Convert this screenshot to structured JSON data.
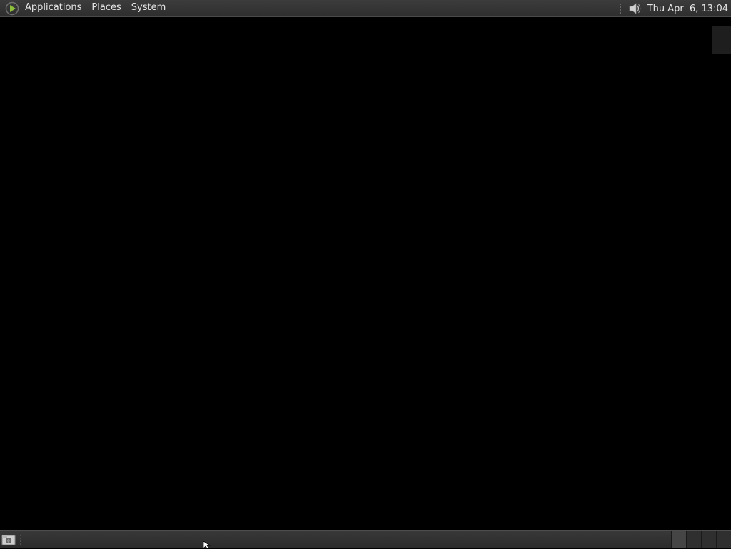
{
  "top_panel": {
    "menus": [
      {
        "label": "Applications"
      },
      {
        "label": "Places"
      },
      {
        "label": "System"
      }
    ],
    "logo_icon": "mandriva-star-icon",
    "tray": {
      "volume_icon": "speaker-volume-icon",
      "clock": "Thu Apr  6, 13:04"
    }
  },
  "bottom_panel": {
    "show_desktop_icon": "show-desktop-icon",
    "workspaces": [
      {
        "name": "workspace-1",
        "active": true
      },
      {
        "name": "workspace-2",
        "active": false
      },
      {
        "name": "workspace-3",
        "active": false
      },
      {
        "name": "workspace-4",
        "active": false
      }
    ]
  },
  "colors": {
    "panel": "#353535",
    "desktop": "#000000",
    "text": "#e6e6e6",
    "logo_accent": "#8bbf3c"
  }
}
